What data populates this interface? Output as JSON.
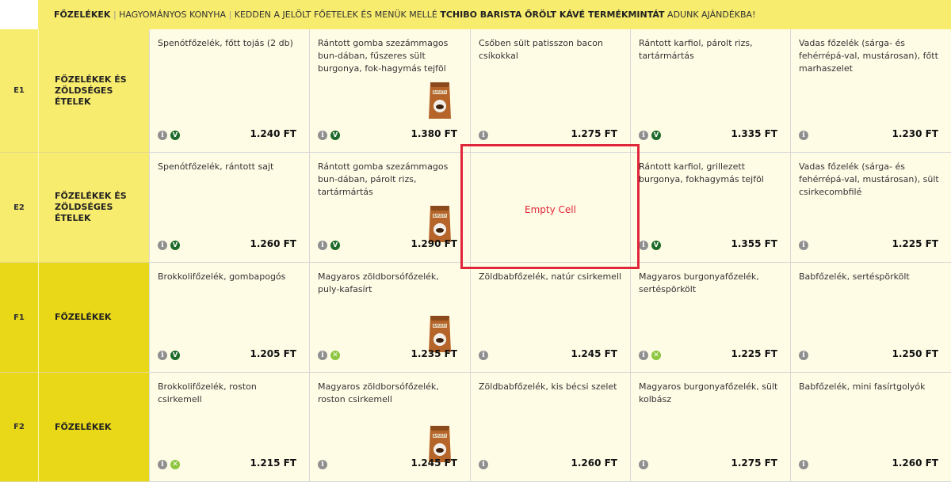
{
  "banner": {
    "category": "FŐZELÉKEK",
    "text1": "HAGYOMÁNYOS KONYHA",
    "text2": "KEDDEN A JELÖLT FŐETELEK ÉS MENÜK MELLÉ",
    "highlight": "TCHIBO BARISTA ŐRÖLT KÁVÉ TERMÉKMINTÁT",
    "text3": "ADUNK AJÁNDÉKBA!"
  },
  "coffee_label": "BARISTA",
  "empty_label": "Empty Cell",
  "rows": [
    {
      "code": "E1",
      "category": "FŐZELÉKEK ÉS ZÖLDSÉGES ÉTELEK",
      "shade": "e",
      "dishes": [
        {
          "name": "Spenótfőzelék, főtt tojás (2 db)",
          "price": "1.240 FT",
          "badges": [
            "info",
            "v"
          ],
          "coffee": false
        },
        {
          "name": "Rántott gomba szezámmagos bun-dában, fűszeres sült burgonya, fok-hagymás tejföl",
          "price": "1.380 FT",
          "badges": [
            "info",
            "v"
          ],
          "coffee": true
        },
        {
          "name": "Csőben sült patisszon bacon csíkokkal",
          "price": "1.275 FT",
          "badges": [
            "info"
          ],
          "coffee": false
        },
        {
          "name": "Rántott karfiol, párolt rizs, tartármártás",
          "price": "1.335 FT",
          "badges": [
            "info",
            "v"
          ],
          "coffee": false
        },
        {
          "name": "Vadas főzelék (sárga- és fehérrépá-val, mustárosan), főtt marhaszelet",
          "price": "1.230 FT",
          "badges": [
            "info"
          ],
          "coffee": false
        }
      ]
    },
    {
      "code": "E2",
      "category": "FŐZELÉKEK ÉS ZÖLDSÉGES ÉTELEK",
      "shade": "e",
      "dishes": [
        {
          "name": "Spenótfőzelék, rántott sajt",
          "price": "1.260 FT",
          "badges": [
            "info",
            "v"
          ],
          "coffee": false
        },
        {
          "name": "Rántott gomba szezámmagos bun-dában, párolt rizs, tartármártás",
          "price": "1.290 FT",
          "badges": [
            "info",
            "v"
          ],
          "coffee": true
        },
        {
          "empty": true
        },
        {
          "name": "Rántott karfiol, grillezett burgonya, fokhagymás tejföl",
          "price": "1.355 FT",
          "badges": [
            "info",
            "v"
          ],
          "coffee": false
        },
        {
          "name": "Vadas főzelék (sárga- és fehérrépá-val, mustárosan), sült csirkecombfilé",
          "price": "1.225 FT",
          "badges": [
            "info"
          ],
          "coffee": false
        }
      ]
    },
    {
      "code": "F1",
      "category": "FŐZELÉKEK",
      "shade": "f",
      "dishes": [
        {
          "name": "Brokkolifőzelék, gombapogós",
          "price": "1.205 FT",
          "badges": [
            "info",
            "v"
          ],
          "coffee": false
        },
        {
          "name": "Magyaros zöldborsófőzelék, puly-kafasírt",
          "price": "1.235 FT",
          "badges": [
            "info",
            "fit"
          ],
          "coffee": true
        },
        {
          "name": "Zöldbabfőzelék, natúr csirkemell",
          "price": "1.245 FT",
          "badges": [
            "info"
          ],
          "coffee": false
        },
        {
          "name": "Magyaros burgonyafőzelék, sertéspörkölt",
          "price": "1.225 FT",
          "badges": [
            "info",
            "fit"
          ],
          "coffee": false
        },
        {
          "name": "Babfőzelék, sertéspörkölt",
          "price": "1.250 FT",
          "badges": [
            "info"
          ],
          "coffee": false
        }
      ]
    },
    {
      "code": "F2",
      "category": "FŐZELÉKEK",
      "shade": "f",
      "dishes": [
        {
          "name": "Brokkolifőzelék, roston csirkemell",
          "price": "1.215 FT",
          "badges": [
            "info",
            "fit"
          ],
          "coffee": false
        },
        {
          "name": "Magyaros zöldborsófőzelék, roston csirkemell",
          "price": "1.245 FT",
          "badges": [
            "info"
          ],
          "coffee": true
        },
        {
          "name": "Zöldbabfőzelék, kis bécsi szelet",
          "price": "1.260 FT",
          "badges": [
            "info"
          ],
          "coffee": false
        },
        {
          "name": "Magyaros burgonyafőzelék, sült kolbász",
          "price": "1.275 FT",
          "badges": [
            "info"
          ],
          "coffee": false
        },
        {
          "name": "Babfőzelék, mini fasírtgolyók",
          "price": "1.260 FT",
          "badges": [
            "info"
          ],
          "coffee": false
        }
      ]
    }
  ],
  "colors": {
    "accent_yellow": "#f8ec6e",
    "dark_yellow": "#e8d817",
    "veg_green": "#1e6b2a",
    "fit_green": "#8cc63e",
    "highlight_red": "#e0263a"
  }
}
